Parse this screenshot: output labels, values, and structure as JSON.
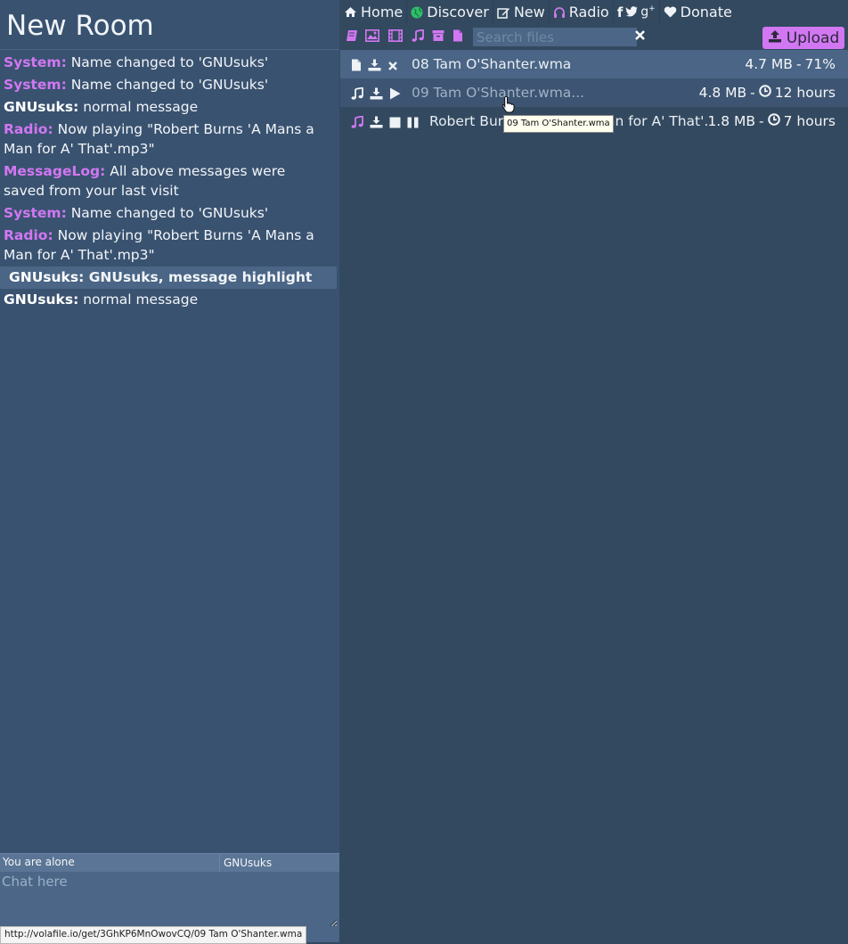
{
  "room": {
    "title": "New Room"
  },
  "nav": {
    "home": "Home",
    "discover": "Discover",
    "new": "New",
    "radio": "Radio",
    "donate": "Donate"
  },
  "search": {
    "placeholder": "Search files"
  },
  "upload": {
    "label": "Upload"
  },
  "messages": [
    {
      "nick": "System:",
      "text": "Name changed to 'GNUsuks'",
      "nick_color": "#d277f2"
    },
    {
      "nick": "System:",
      "text": "Name changed to 'GNUsuks'",
      "nick_color": "#d277f2"
    },
    {
      "nick": "GNUsuks:",
      "text": "normal message",
      "nick_color": "#ffffff"
    },
    {
      "nick": "Radio:",
      "text": "Now playing \"Robert Burns 'A Mans a Man for A' That'.mp3\"",
      "nick_color": "#d277f2"
    },
    {
      "nick": "MessageLog:",
      "text": "All above messages were saved from your last visit",
      "nick_color": "#d277f2"
    },
    {
      "nick": "System:",
      "text": "Name changed to 'GNUsuks'",
      "nick_color": "#d277f2"
    },
    {
      "nick": "Radio:",
      "text": "Now playing \"Robert Burns 'A Mans a Man for A' That'.mp3\"",
      "nick_color": "#d277f2"
    },
    {
      "nick": "GNUsuks:",
      "text": "GNUsuks, message highlight",
      "nick_color": "#ffffff",
      "highlight": true
    },
    {
      "nick": "GNUsuks:",
      "text": "normal message",
      "nick_color": "#ffffff"
    }
  ],
  "chat": {
    "status": "You are alone",
    "nick": "GNUsuks",
    "placeholder": "Chat here"
  },
  "status_url": "http://volafile.io/get/3GhKP6MnOwovCQ/09 Tam O'Shanter.wma",
  "files": [
    {
      "name": "08 Tam O'Shanter.wma",
      "size": "4.7 MB",
      "progress": "71%",
      "type_icon": "file-icon"
    },
    {
      "name": "09 Tam O'Shanter.wma...",
      "size": "4.8 MB",
      "ttl": "12 hours",
      "type_icon": "music-icon"
    },
    {
      "name": "Robert Burns 'A Mans a Man for A' That'...",
      "size": "1.8 MB",
      "ttl": "7 hours",
      "type_icon": "music-icon"
    }
  ],
  "tooltip": "09 Tam O'Shanter.wma",
  "colors": {
    "accent": "#d277f2",
    "panel": "#395270",
    "files_bg": "#33495f",
    "highlight": "#4a6585"
  }
}
